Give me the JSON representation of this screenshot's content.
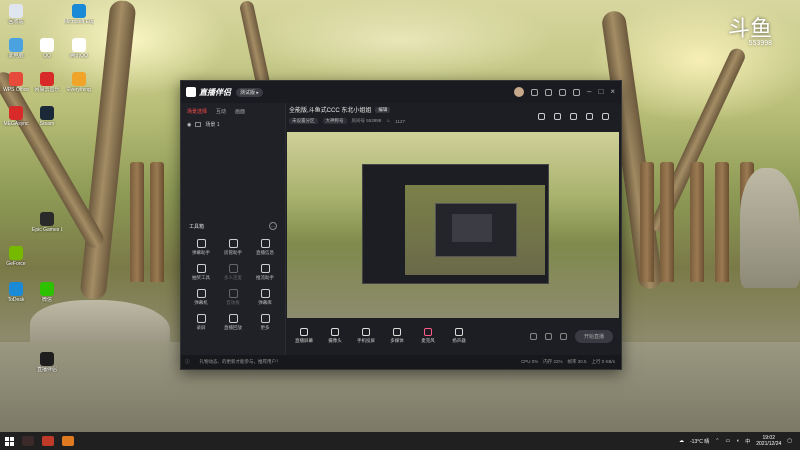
{
  "desktop": {
    "icons": [
      {
        "label": "回收站",
        "color": "#e0e6ef"
      },
      {
        "label": "此电脑",
        "color": "#4aa3e0"
      },
      {
        "label": "QQ",
        "color": "#ffffff"
      },
      {
        "label": "Microsoft Edge",
        "color": "#1a8ad6"
      },
      {
        "label": "腾讯QQ",
        "color": "#ffffff"
      },
      {
        "label": "WPS Office",
        "color": "#e64a3b"
      },
      {
        "label": "网易云音乐",
        "color": "#d92a2a"
      },
      {
        "label": "Everything",
        "color": "#f0a42a"
      },
      {
        "label": "MEGAsync",
        "color": "#d92a2a"
      },
      {
        "label": "Steam",
        "color": "#1b2838"
      },
      {
        "label": "Epic Games Launcher",
        "color": "#2a2a2a"
      },
      {
        "label": "GeForce",
        "color": "#76b900"
      },
      {
        "label": "ToDesk",
        "color": "#1a8ad6"
      },
      {
        "label": "微信",
        "color": "#2dc100"
      },
      {
        "label": "直播伴侣",
        "color": "#1e1e1e"
      }
    ],
    "widget": {
      "big": "斗鱼",
      "small": "553998"
    }
  },
  "app": {
    "name": "直播伴侣",
    "version": "测试版 ▸",
    "sidebar": {
      "tabs": [
        "场景选择",
        "互动",
        "画面"
      ],
      "active_tab": 0,
      "scene": "场景 1",
      "toolbox_title": "工具箱",
      "tools": [
        {
          "label": "弹幕助手",
          "dim": false
        },
        {
          "label": "房管助手",
          "dim": false
        },
        {
          "label": "直播信息",
          "dim": false
        },
        {
          "label": "抽奖工具",
          "dim": false
        },
        {
          "label": "多人连麦",
          "dim": true
        },
        {
          "label": "推流助手",
          "dim": false
        },
        {
          "label": "弹幕机",
          "dim": false
        },
        {
          "label": "音效板",
          "dim": true
        },
        {
          "label": "弹幕库",
          "dim": false
        },
        {
          "label": "录屏",
          "dim": false
        },
        {
          "label": "直播回放",
          "dim": false
        },
        {
          "label": "更多",
          "dim": false
        }
      ]
    },
    "live_info": {
      "title": "全能版,斗鱼式CCC 东北小姐姐",
      "edit": "编辑",
      "tags": [
        "未设置分区",
        "大神称号"
      ],
      "room_label": "房间号 553998",
      "fans": "1127"
    },
    "bottom_buttons": [
      {
        "label": "直播屏幕",
        "mic": false
      },
      {
        "label": "摄像头",
        "mic": false
      },
      {
        "label": "手机投屏",
        "mic": false
      },
      {
        "label": "多媒体",
        "mic": false
      },
      {
        "label": "麦克风",
        "mic": true
      },
      {
        "label": "扬声器",
        "mic": false
      }
    ],
    "start_label": "开始直播",
    "status": {
      "notice": "礼物动态、的更新才能参与，推荐用户！",
      "stats": [
        "CPU 0%",
        "内存 22%",
        "帧率 30.5",
        "上行 0 KB/s"
      ]
    }
  },
  "taskbar": {
    "temperature": "-13°C 晴",
    "ime": "中",
    "time": "19:02",
    "date": "2021/12/24"
  }
}
